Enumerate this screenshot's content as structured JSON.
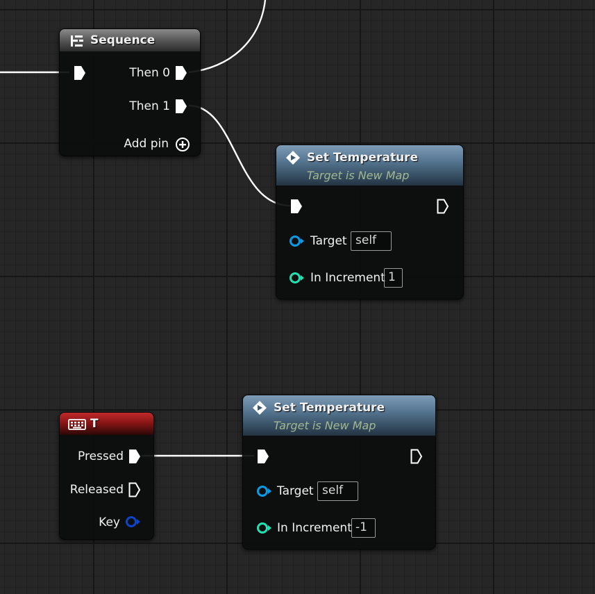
{
  "sequence_node": {
    "title": "Sequence",
    "outputs": [
      {
        "label": "Then 0"
      },
      {
        "label": "Then 1"
      }
    ],
    "add_pin_label": "Add pin"
  },
  "set_temperature_nodes": [
    {
      "title": "Set Temperature",
      "subtitle": "Target is New Map",
      "target_label": "Target",
      "target_value": "self",
      "increment_label": "In Increment",
      "increment_value": "1"
    },
    {
      "title": "Set Temperature",
      "subtitle": "Target is New Map",
      "target_label": "Target",
      "target_value": "self",
      "increment_label": "In Increment",
      "increment_value": "-1"
    }
  ],
  "key_event_node": {
    "title": "T",
    "pressed_label": "Pressed",
    "released_label": "Released",
    "key_label": "Key"
  },
  "colors": {
    "exec_wire": "#ffffff",
    "object_pin": "#0a9be8",
    "int_pin": "#1fe3b0",
    "struct_pin": "#0b45c9",
    "subtitle": "#a2b892"
  },
  "icons": {
    "sequence": "sequence-icon",
    "function": "function-icon",
    "keyboard": "keyboard-icon",
    "add_pin": "add-circle-icon"
  }
}
